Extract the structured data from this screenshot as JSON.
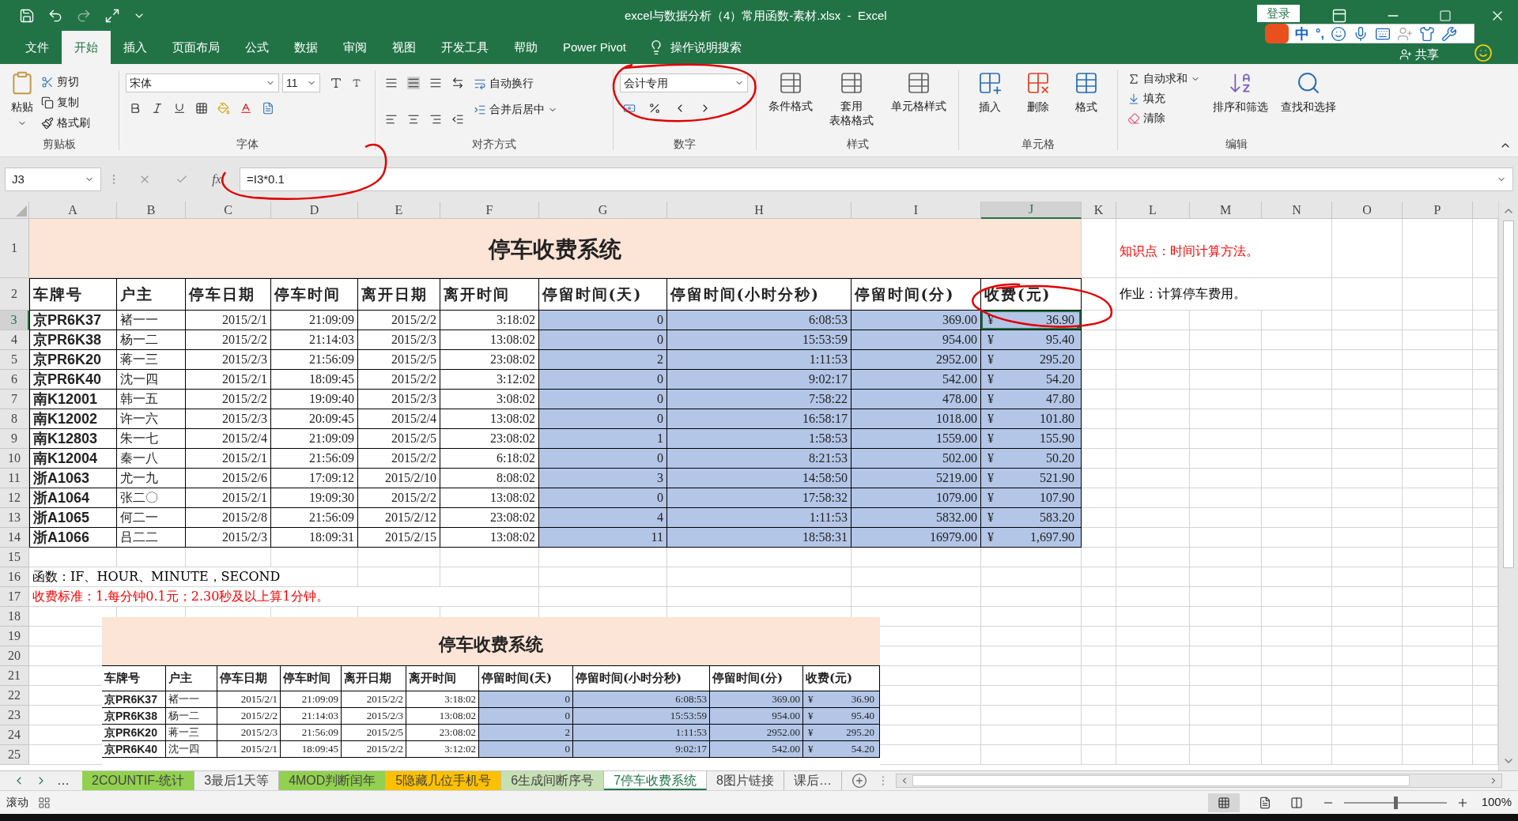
{
  "window": {
    "title": "excel与数据分析（4）常用函数-素材.xlsx  -  Excel",
    "login": "登录",
    "share": "共享"
  },
  "ime_bar": {
    "mode": "中",
    "punct": "°,"
  },
  "ribbon_tabs": [
    {
      "label": "文件",
      "selected": false
    },
    {
      "label": "开始",
      "selected": true
    },
    {
      "label": "插入",
      "selected": false
    },
    {
      "label": "页面布局",
      "selected": false
    },
    {
      "label": "公式",
      "selected": false
    },
    {
      "label": "数据",
      "selected": false
    },
    {
      "label": "审阅",
      "selected": false
    },
    {
      "label": "视图",
      "selected": false
    },
    {
      "label": "开发工具",
      "selected": false
    },
    {
      "label": "帮助",
      "selected": false
    },
    {
      "label": "Power Pivot",
      "selected": false
    }
  ],
  "tell_me": "操作说明搜索",
  "clipboard": {
    "paste": "粘贴",
    "cut": "剪切",
    "copy": "复制",
    "format_painter": "格式刷",
    "label": "剪贴板"
  },
  "font": {
    "name": "宋体",
    "size": "11",
    "label": "字体"
  },
  "alignment": {
    "wrap": "自动换行",
    "merge": "合并后居中",
    "label": "对齐方式"
  },
  "number": {
    "format": "会计专用",
    "label": "数字"
  },
  "styles": {
    "buttons": [
      {
        "lines": [
          "条件格式"
        ]
      },
      {
        "lines": [
          "套用",
          "表格格式"
        ]
      },
      {
        "lines": [
          "单元格样式"
        ]
      }
    ],
    "label": "样式"
  },
  "cells": {
    "buttons": [
      "插入",
      "删除",
      "格式"
    ],
    "label": "单元格"
  },
  "editing": {
    "autosum": "自动求和",
    "fill": "填充",
    "clear": "清除",
    "sort": "排序和筛选",
    "find": "查找和选择",
    "label": "编辑"
  },
  "formula_bar": {
    "name_box": "J3",
    "fx": "fx",
    "formula": "=I3*0.1"
  },
  "columns": [
    {
      "label": "A",
      "selected": false
    },
    {
      "label": "B",
      "selected": false
    },
    {
      "label": "C",
      "selected": false
    },
    {
      "label": "D",
      "selected": false
    },
    {
      "label": "E",
      "selected": false
    },
    {
      "label": "F",
      "selected": false
    },
    {
      "label": "G",
      "selected": false
    },
    {
      "label": "H",
      "selected": false
    },
    {
      "label": "I",
      "selected": false
    },
    {
      "label": "J",
      "selected": true
    },
    {
      "label": "K",
      "selected": false
    },
    {
      "label": "L",
      "selected": false
    },
    {
      "label": "M",
      "selected": false
    },
    {
      "label": "N",
      "selected": false
    },
    {
      "label": "O",
      "selected": false
    },
    {
      "label": "P",
      "selected": false
    }
  ],
  "row_numbers": [
    {
      "label": "1",
      "selected": false
    },
    {
      "label": "2",
      "selected": false
    },
    {
      "label": "3",
      "selected": true
    },
    {
      "label": "4",
      "selected": false
    },
    {
      "label": "5",
      "selected": false
    },
    {
      "label": "6",
      "selected": false
    },
    {
      "label": "7",
      "selected": false
    },
    {
      "label": "8",
      "selected": false
    },
    {
      "label": "9",
      "selected": false
    },
    {
      "label": "10",
      "selected": false
    },
    {
      "label": "11",
      "selected": false
    },
    {
      "label": "12",
      "selected": false
    },
    {
      "label": "13",
      "selected": false
    },
    {
      "label": "14",
      "selected": false
    },
    {
      "label": "15",
      "selected": false
    },
    {
      "label": "16",
      "selected": false
    },
    {
      "label": "17",
      "selected": false
    },
    {
      "label": "18",
      "selected": false
    },
    {
      "label": "19",
      "selected": false
    },
    {
      "label": "20",
      "selected": false
    },
    {
      "label": "21",
      "selected": false
    },
    {
      "label": "22",
      "selected": false
    },
    {
      "label": "23",
      "selected": false
    },
    {
      "label": "24",
      "selected": false
    },
    {
      "label": "25",
      "selected": false
    }
  ],
  "sheet": {
    "title": "停车收费系统",
    "headers": [
      "车牌号",
      "户主",
      "停车日期",
      "停车时间",
      "离开日期",
      "离开时间",
      "停留时间(天)",
      "停留时间(小时分秒)",
      "停留时间(分)",
      "收费(元)"
    ],
    "rows": [
      {
        "cells": [
          "京PR6K37",
          "褚一一",
          "2015/2/1",
          "21:09:09",
          "2015/2/2",
          "3:18:02",
          "0",
          "6:08:53",
          "369.00"
        ],
        "currency": "¥",
        "fee": "36.90",
        "selected": true
      },
      {
        "cells": [
          "京PR6K38",
          "杨一二",
          "2015/2/2",
          "21:14:03",
          "2015/2/3",
          "13:08:02",
          "0",
          "15:53:59",
          "954.00"
        ],
        "currency": "¥",
        "fee": "95.40",
        "selected": false
      },
      {
        "cells": [
          "京PR6K20",
          "蒋一三",
          "2015/2/3",
          "21:56:09",
          "2015/2/5",
          "23:08:02",
          "2",
          "1:11:53",
          "2952.00"
        ],
        "currency": "¥",
        "fee": "295.20",
        "selected": false
      },
      {
        "cells": [
          "京PR6K40",
          "沈一四",
          "2015/2/1",
          "18:09:45",
          "2015/2/2",
          "3:12:02",
          "0",
          "9:02:17",
          "542.00"
        ],
        "currency": "¥",
        "fee": "54.20",
        "selected": false
      },
      {
        "cells": [
          "南K12001",
          "韩一五",
          "2015/2/2",
          "19:09:40",
          "2015/2/3",
          "3:08:02",
          "0",
          "7:58:22",
          "478.00"
        ],
        "currency": "¥",
        "fee": "47.80",
        "selected": false
      },
      {
        "cells": [
          "南K12002",
          "许一六",
          "2015/2/3",
          "20:09:45",
          "2015/2/4",
          "13:08:02",
          "0",
          "16:58:17",
          "1018.00"
        ],
        "currency": "¥",
        "fee": "101.80",
        "selected": false
      },
      {
        "cells": [
          "南K12803",
          "朱一七",
          "2015/2/4",
          "21:09:09",
          "2015/2/5",
          "23:08:02",
          "1",
          "1:58:53",
          "1559.00"
        ],
        "currency": "¥",
        "fee": "155.90",
        "selected": false
      },
      {
        "cells": [
          "南K12004",
          "秦一八",
          "2015/2/1",
          "21:56:09",
          "2015/2/2",
          "6:18:02",
          "0",
          "8:21:53",
          "502.00"
        ],
        "currency": "¥",
        "fee": "50.20",
        "selected": false
      },
      {
        "cells": [
          "浙A1063",
          "尤一九",
          "2015/2/6",
          "17:09:12",
          "2015/2/10",
          "8:08:02",
          "3",
          "14:58:50",
          "5219.00"
        ],
        "currency": "¥",
        "fee": "521.90",
        "selected": false
      },
      {
        "cells": [
          "浙A1064",
          "张二〇",
          "2015/2/1",
          "19:09:30",
          "2015/2/2",
          "13:08:02",
          "0",
          "17:58:32",
          "1079.00"
        ],
        "currency": "¥",
        "fee": "107.90",
        "selected": false
      },
      {
        "cells": [
          "浙A1065",
          "何二一",
          "2015/2/8",
          "21:56:09",
          "2015/2/12",
          "23:08:02",
          "4",
          "1:11:53",
          "5832.00"
        ],
        "currency": "¥",
        "fee": "583.20",
        "selected": false
      },
      {
        "cells": [
          "浙A1066",
          "吕二二",
          "2015/2/3",
          "18:09:31",
          "2015/2/15",
          "13:08:02",
          "11",
          "18:58:31",
          "16979.00"
        ],
        "currency": "¥",
        "fee": "1,697.90",
        "selected": false
      }
    ],
    "notes": [
      {
        "text": "知识点：时间计算方法。",
        "color": "#ff0000"
      },
      {
        "text": "作业：计算停车费用。",
        "color": "#000000"
      },
      {
        "text": "函数：IF、HOUR、MINUTE，SECOND",
        "color": "#000000"
      },
      {
        "text": "收费标准：1.每分钟0.1元；2.30秒及以上算1分钟。",
        "color": "#ff0000"
      }
    ]
  },
  "picture": {
    "title": "停车收费系统",
    "headers": [
      "车牌号",
      "户主",
      "停车日期",
      "停车时间",
      "离开日期",
      "离开时间",
      "停留时间(天)",
      "停留时间(小时分秒)",
      "停留时间(分)",
      "收费(元)"
    ],
    "rows": [
      {
        "cells": [
          "京PR6K37",
          "褚一一",
          "2015/2/1",
          "21:09:09",
          "2015/2/2",
          "3:18:02",
          "0",
          "6:08:53",
          "369.00"
        ],
        "currency": "¥",
        "fee": "36.90"
      },
      {
        "cells": [
          "京PR6K38",
          "杨一二",
          "2015/2/2",
          "21:14:03",
          "2015/2/3",
          "13:08:02",
          "0",
          "15:53:59",
          "954.00"
        ],
        "currency": "¥",
        "fee": "95.40"
      },
      {
        "cells": [
          "京PR6K20",
          "蒋一三",
          "2015/2/3",
          "21:56:09",
          "2015/2/5",
          "23:08:02",
          "2",
          "1:11:53",
          "2952.00"
        ],
        "currency": "¥",
        "fee": "295.20"
      },
      {
        "cells": [
          "京PR6K40",
          "沈一四",
          "2015/2/1",
          "18:09:45",
          "2015/2/2",
          "3:12:02",
          "0",
          "9:02:17",
          "542.00"
        ],
        "currency": "¥",
        "fee": "54.20"
      }
    ]
  },
  "tab_overflow": "…",
  "sheet_tabs": [
    {
      "label": "2COUNTIF-统计",
      "color": "#92d050",
      "selected": false
    },
    {
      "label": "3最后1天等",
      "selected": false
    },
    {
      "label": "4MOD判断闰年",
      "color": "#92d050",
      "selected": false
    },
    {
      "label": "5隐藏几位手机号",
      "color": "#ffc000",
      "selected": false
    },
    {
      "label": "6生成间断序号",
      "color": "#c6e0b4",
      "selected": false
    },
    {
      "label": "7停车收费系统",
      "selected": true
    },
    {
      "label": "8图片链接",
      "selected": false
    },
    {
      "label": "课后…",
      "selected": false
    }
  ],
  "status": {
    "mode": "滚动",
    "zoom": "100%",
    "zoom_slider": {
      "level": 0.5
    }
  }
}
